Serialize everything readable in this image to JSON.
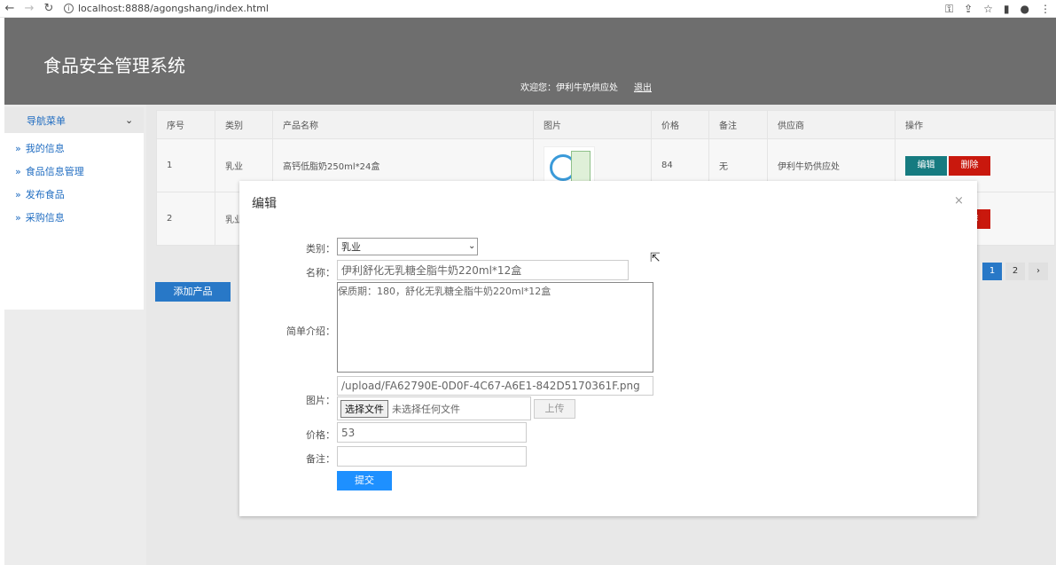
{
  "browser": {
    "url": "localhost:8888/agongshang/index.html"
  },
  "header": {
    "title": "食品安全管理系统",
    "welcome": "欢迎您：伊利牛奶供应处",
    "logout": "退出"
  },
  "sidebar": {
    "menu_title": "导航菜单",
    "items": [
      {
        "label": "我的信息"
      },
      {
        "label": "食品信息管理"
      },
      {
        "label": "发布食品"
      },
      {
        "label": "采购信息"
      }
    ]
  },
  "table": {
    "columns": [
      "序号",
      "类别",
      "产品名称",
      "图片",
      "价格",
      "备注",
      "供应商",
      "操作"
    ],
    "rows": [
      {
        "no": "1",
        "category": "乳业",
        "name": "高钙低脂奶250ml*24盒",
        "price": "84",
        "note": "无",
        "supplier": "伊利牛奶供应处"
      },
      {
        "no": "2",
        "category": "乳业"
      }
    ],
    "edit_label": "编辑",
    "delete_label": "删除"
  },
  "add_button": "添加产品",
  "pagination": {
    "pages": [
      "1",
      "2"
    ],
    "next": "›",
    "current": "1"
  },
  "modal": {
    "title": "编辑",
    "close": "×",
    "labels": {
      "category": "类别：",
      "name": "名称：",
      "intro": "简单介绍：",
      "image": "图片：",
      "price": "价格：",
      "note": "备注："
    },
    "category_value": "乳业",
    "name_value": "伊利舒化无乳糖全脂牛奶220ml*12盒",
    "intro_value": "保质期：180，舒化无乳糖全脂牛奶220ml*12盒",
    "image_path": "/upload/FA62790E-0D0F-4C67-A6E1-842D5170361F.png",
    "file_button": "选择文件",
    "file_none": "未选择任何文件",
    "upload_button": "上传",
    "price_value": "53",
    "note_value": "",
    "submit": "提交"
  }
}
